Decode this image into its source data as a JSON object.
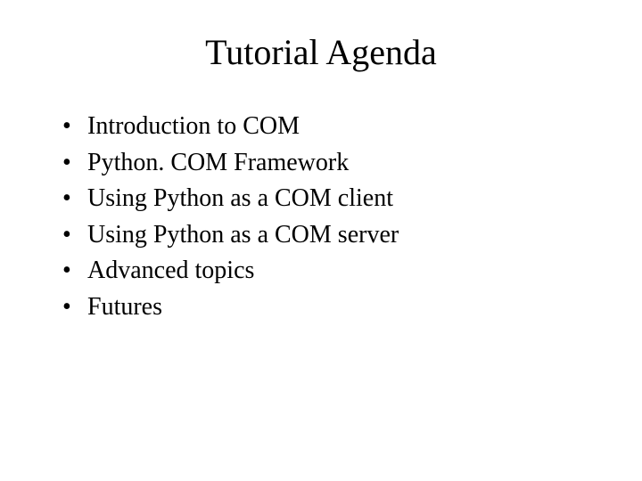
{
  "slide": {
    "title": "Tutorial Agenda",
    "bullets": [
      "Introduction to COM",
      "Python. COM Framework",
      "Using Python as a COM client",
      "Using Python as a COM server",
      "Advanced topics",
      "Futures"
    ]
  }
}
